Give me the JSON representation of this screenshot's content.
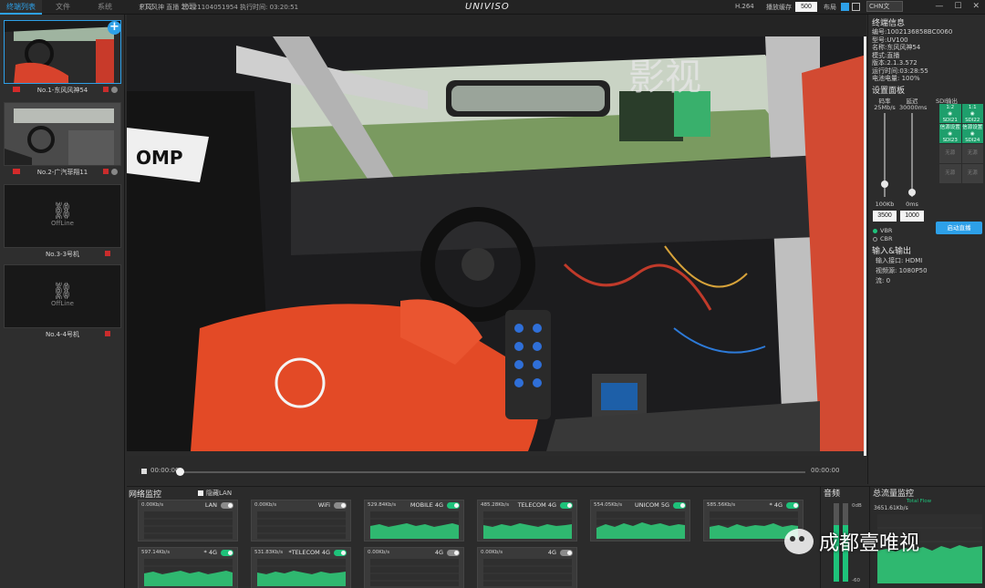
{
  "topbar": {
    "tabs": [
      "终端列表",
      "文件",
      "系统",
      "PTZ",
      "管理"
    ],
    "active_tab": 0,
    "info": "东风风神 直播 20221104051954 执行时间: 03:20:51",
    "logo": "UNIVISO",
    "codec": "H.264",
    "buffer_label": "播放缓存",
    "buffer_value": "500",
    "layout_label": "布局",
    "language": "CHN文",
    "window_buttons": [
      "—",
      "☐",
      "✕"
    ]
  },
  "cameras": [
    {
      "name": "No.1-东风风神54",
      "status": "online"
    },
    {
      "name": "No.2-广汽菲翔11",
      "status": "online"
    },
    {
      "name": "No.3-3号机",
      "status": "offline",
      "offline_text": "OffLine"
    },
    {
      "name": "No.4-4号机",
      "status": "offline",
      "offline_text": "OffLine"
    }
  ],
  "add_button": "+",
  "video_overlay_text": "影视",
  "playback": {
    "time_start": "00:00:00",
    "time_end": "00:00:00",
    "progress": 0
  },
  "terminal": {
    "title": "终端信息",
    "fields": [
      "编号:1002136858BC0060",
      "型号:UV100",
      "名称:东风风神54",
      "模式:直播",
      "版本:2.1.3.572",
      "运行时间:03:28:55",
      "电池电量: 100%"
    ]
  },
  "settings": {
    "title": "设置面板",
    "bitrate_label": "码率",
    "bitrate_top": "25Mb/s",
    "bitrate_bottom": "100Kb",
    "bitrate_value": "3500",
    "bitrate_level": 0.15,
    "latency_label": "延迟",
    "latency_top": "30000ms",
    "latency_bottom": "0ms",
    "latency_value": "1000",
    "latency_level": 0.05,
    "sdi_title": "SDI输出",
    "sdi_cells": [
      {
        "top": "1:2",
        "bottom": "SDI21",
        "on": true
      },
      {
        "top": "1:1",
        "bottom": "SDI22",
        "on": true
      },
      {
        "top": "信源设置",
        "bottom": "SDI23",
        "on": true
      },
      {
        "top": "信源设置",
        "bottom": "SDI24",
        "on": true
      },
      {
        "top": "无源",
        "bottom": "",
        "on": false
      },
      {
        "top": "无源",
        "bottom": "",
        "on": false
      },
      {
        "top": "无源",
        "bottom": "",
        "on": false
      },
      {
        "top": "无源",
        "bottom": "",
        "on": false
      }
    ],
    "vbr": "VBR",
    "cbr": "CBR",
    "start_button": "启动直播"
  },
  "io": {
    "title": "输入&输出",
    "fields": [
      "输入接口: HDMI",
      "视频源: 1080P50",
      "流: 0"
    ]
  },
  "network": {
    "title": "网络监控",
    "hide_lan": "隐藏LAN",
    "boxes": [
      {
        "rate": "0.00Kb/s",
        "name": "LAN",
        "on": false
      },
      {
        "rate": "0.00Kb/s",
        "name": "WiFi",
        "on": false
      },
      {
        "rate": "529.84Kb/s",
        "name": "MOBILE 4G",
        "on": true
      },
      {
        "rate": "485.28Kb/s",
        "name": "TELECOM 4G",
        "on": true
      },
      {
        "rate": "554.05Kb/s",
        "name": "UNICOM 5G",
        "on": true
      },
      {
        "rate": "585.56Kb/s",
        "name": "* 4G",
        "on": true
      },
      {
        "rate": "597.14Kb/s",
        "name": "* 4G",
        "on": true
      },
      {
        "rate": "531.83Kb/s",
        "name": "*TELECOM 4G",
        "on": true
      },
      {
        "rate": "0.00Kb/s",
        "name": "4G",
        "on": false
      },
      {
        "rate": "0.00Kb/s",
        "name": "4G",
        "on": false
      }
    ]
  },
  "audio": {
    "title": "音频",
    "top_label": "0dB",
    "bottom_label": "-60",
    "level_left": 0.72,
    "level_right": 0.72
  },
  "total": {
    "title": "总流量监控",
    "rate": "3651.61Kb/s",
    "plot_label": "Total Flow"
  },
  "watermark": "成都壹唯视",
  "colors": {
    "accent": "#2da0e8",
    "online": "#1ec27a",
    "rec": "#d32a2a"
  }
}
